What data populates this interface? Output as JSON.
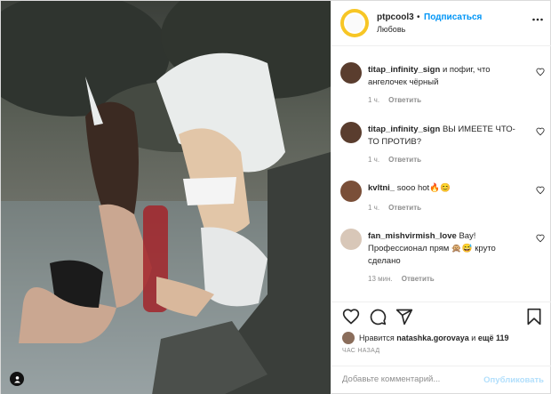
{
  "header": {
    "username": "ptpcool3",
    "separator": "•",
    "follow_label": "Подписаться",
    "location": "Любовь"
  },
  "comments": [
    {
      "user": "titap_infinity_sign",
      "text": "и пофиг, что ангелочек чёрный",
      "time": "1 ч.",
      "reply": "Ответить",
      "avatar_color": "#5a3d2e"
    },
    {
      "user": "titap_infinity_sign",
      "text": "ВЫ ИМЕЕТЕ ЧТО-ТО ПРОТИВ?",
      "time": "1 ч.",
      "reply": "Ответить",
      "avatar_color": "#5a3d2e"
    },
    {
      "user": "kvltni_",
      "text": "sooo hot🔥😊",
      "time": "1 ч.",
      "reply": "Ответить",
      "avatar_color": "#7a4f38"
    },
    {
      "user": "fan_mishvirmish_love",
      "text": "Вау! Профессионал прям 🙊😅 круто сделано",
      "time": "13 мин.",
      "reply": "Ответить",
      "avatar_color": "#d8c7b8"
    }
  ],
  "likes": {
    "prefix": "Нравится",
    "user": "natashka.gorovaya",
    "mid": "и",
    "count": "ещё 119"
  },
  "time_ago": "ЧАС НАЗАД",
  "add_comment": {
    "placeholder": "Добавьте комментарий...",
    "publish": "Опубликовать"
  },
  "icons": {
    "more": "more-icon",
    "heart": "heart-icon",
    "comment": "comment-icon",
    "share": "share-icon",
    "bookmark": "bookmark-icon",
    "user_tag": "user-tag-icon"
  },
  "colors": {
    "accent": "#0095f6",
    "muted": "#8e8e8e",
    "publish_disabled": "#b2dffc",
    "story_ring": "#f7c625"
  }
}
